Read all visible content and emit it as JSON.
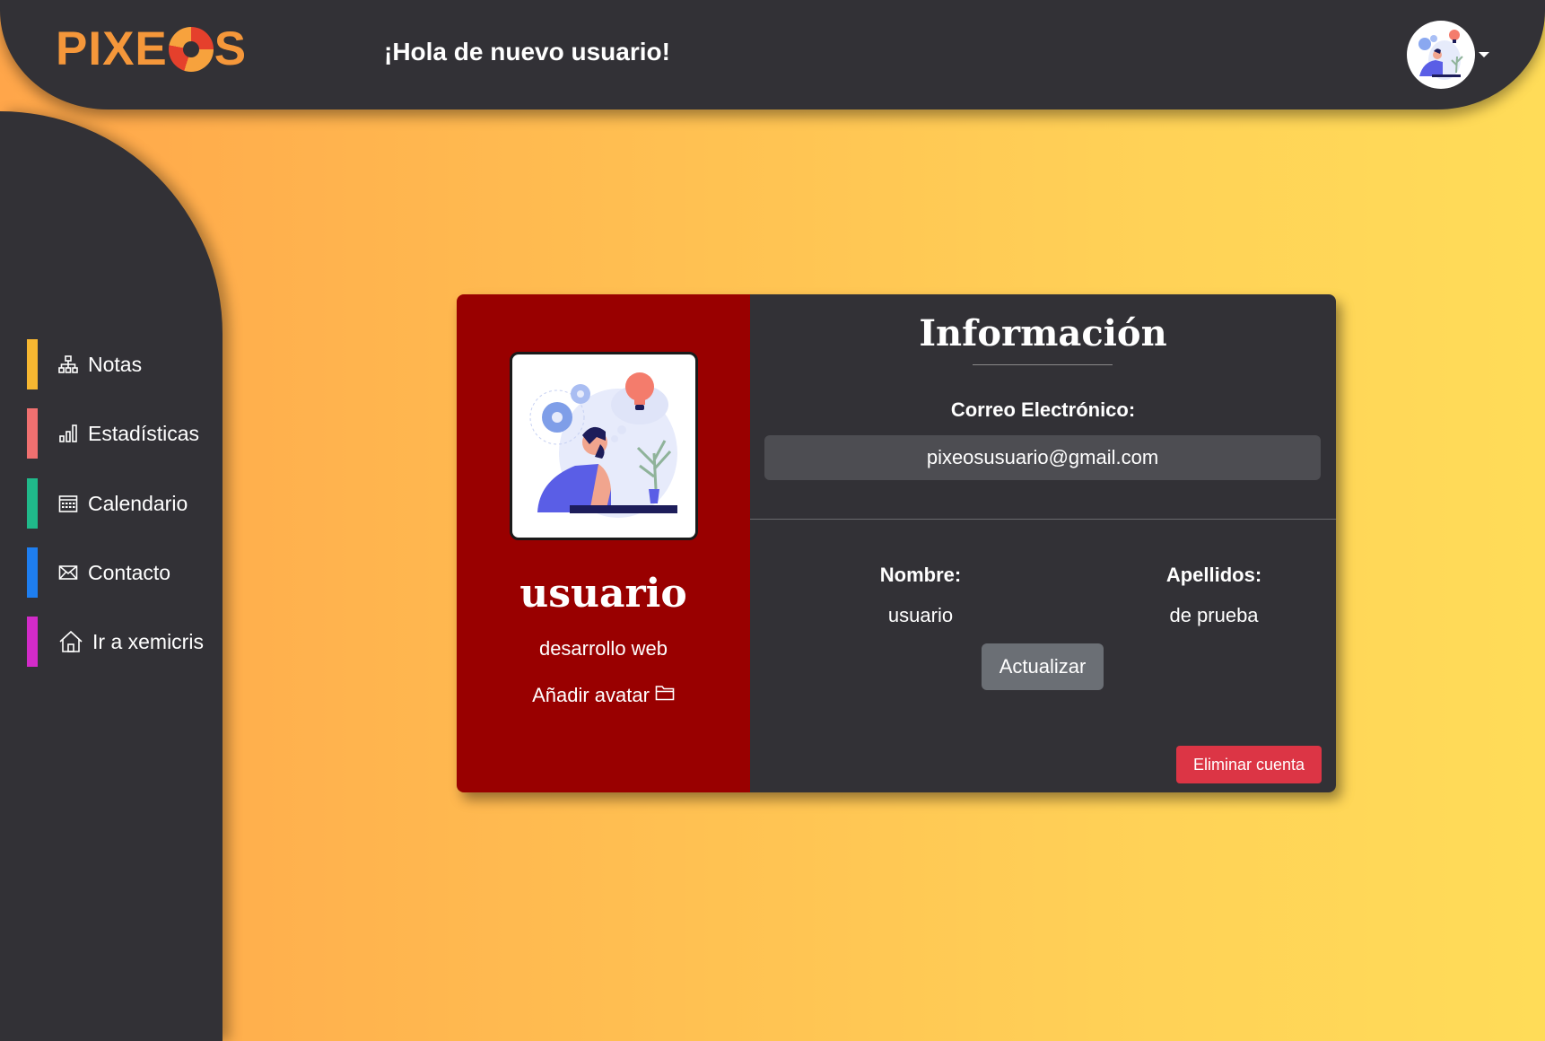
{
  "header": {
    "logo_text_left": "PIXE",
    "logo_text_right": "S",
    "greeting": "¡Hola de nuevo usuario!",
    "avatar_icon": "user-avatar-illustration",
    "caret_icon": "caret-down-icon"
  },
  "sidebar": {
    "items": [
      {
        "label": "Notas",
        "icon": "sitemap-icon",
        "color": "#f7b731"
      },
      {
        "label": "Estadísticas",
        "icon": "bar-chart-icon",
        "color": "#f07070"
      },
      {
        "label": "Calendario",
        "icon": "calendar-icon",
        "color": "#20b98a"
      },
      {
        "label": "Contacto",
        "icon": "envelope-icon",
        "color": "#1e7ef0"
      },
      {
        "label": "Ir a xemicris",
        "icon": "home-icon",
        "color": "#d22bc8"
      }
    ]
  },
  "profile": {
    "username": "usuario",
    "role": "desarrollo web",
    "add_avatar_label": "Añadir avatar",
    "add_avatar_icon": "folder-icon"
  },
  "info": {
    "title": "Información",
    "email_label": "Correo Electrónico:",
    "email_value": "pixeosusuario@gmail.com",
    "name_label": "Nombre:",
    "name_value": "usuario",
    "surname_label": "Apellidos:",
    "surname_value": "de prueba",
    "update_button": "Actualizar",
    "delete_button": "Eliminar cuenta"
  },
  "colors": {
    "panel_dark": "#323136",
    "card_left": "#990000",
    "delete": "#dc3545",
    "update": "#6b6f75",
    "logo": "#f5973a"
  }
}
